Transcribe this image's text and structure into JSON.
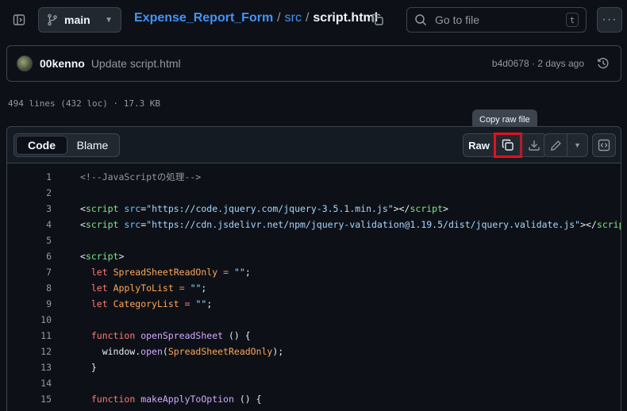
{
  "header": {
    "branch": "main",
    "breadcrumb": {
      "repo": "Expense_Report_Form",
      "sep1": "/",
      "dir": "src",
      "sep2": "/",
      "file": "script.html"
    },
    "search_placeholder": "Go to file",
    "search_shortcut": "t"
  },
  "commit": {
    "author": "00kenno",
    "message": "Update script.html",
    "meta": "b4d0678 · 2 days ago"
  },
  "file_info": "494 lines (432 loc) · 17.3 KB",
  "file_header": {
    "tabs": [
      "Code",
      "Blame"
    ],
    "active_tab": "Code",
    "raw_label": "Raw",
    "tooltip": "Copy raw file"
  },
  "code_lines": [
    {
      "n": "1",
      "tokens": [
        [
          "c",
          "<!--JavaScriptの処理-->"
        ]
      ]
    },
    {
      "n": "2",
      "tokens": []
    },
    {
      "n": "3",
      "tokens": [
        [
          "p",
          "<"
        ],
        [
          "t",
          "script"
        ],
        [
          "p",
          " "
        ],
        [
          "a",
          "src"
        ],
        [
          "p",
          "="
        ],
        [
          "s",
          "\"https://code.jquery.com/jquery-3.5.1.min.js\""
        ],
        [
          "p",
          "></"
        ],
        [
          "t",
          "script"
        ],
        [
          "p",
          ">"
        ]
      ]
    },
    {
      "n": "4",
      "tokens": [
        [
          "p",
          "<"
        ],
        [
          "t",
          "script"
        ],
        [
          "p",
          " "
        ],
        [
          "a",
          "src"
        ],
        [
          "p",
          "="
        ],
        [
          "s",
          "\"https://cdn.jsdelivr.net/npm/jquery-validation@1.19.5/dist/jquery.validate.js\""
        ],
        [
          "p",
          "></"
        ],
        [
          "t",
          "script"
        ],
        [
          "p",
          ">"
        ]
      ]
    },
    {
      "n": "5",
      "tokens": []
    },
    {
      "n": "6",
      "tokens": [
        [
          "p",
          "<"
        ],
        [
          "t",
          "script"
        ],
        [
          "p",
          ">"
        ]
      ]
    },
    {
      "n": "7",
      "tokens": [
        [
          "p",
          "  "
        ],
        [
          "k",
          "let"
        ],
        [
          "p",
          " "
        ],
        [
          "v",
          "SpreadSheetReadOnly"
        ],
        [
          "p",
          " "
        ],
        [
          "k",
          "="
        ],
        [
          "p",
          " "
        ],
        [
          "s",
          "\"\""
        ],
        [
          "p",
          ";"
        ]
      ]
    },
    {
      "n": "8",
      "tokens": [
        [
          "p",
          "  "
        ],
        [
          "k",
          "let"
        ],
        [
          "p",
          " "
        ],
        [
          "v",
          "ApplyToList"
        ],
        [
          "p",
          " "
        ],
        [
          "k",
          "="
        ],
        [
          "p",
          " "
        ],
        [
          "s",
          "\"\""
        ],
        [
          "p",
          ";"
        ]
      ]
    },
    {
      "n": "9",
      "tokens": [
        [
          "p",
          "  "
        ],
        [
          "k",
          "let"
        ],
        [
          "p",
          " "
        ],
        [
          "v",
          "CategoryList"
        ],
        [
          "p",
          " "
        ],
        [
          "k",
          "="
        ],
        [
          "p",
          " "
        ],
        [
          "s",
          "\"\""
        ],
        [
          "p",
          ";"
        ]
      ]
    },
    {
      "n": "10",
      "tokens": []
    },
    {
      "n": "11",
      "tokens": [
        [
          "p",
          "  "
        ],
        [
          "k",
          "function"
        ],
        [
          "p",
          " "
        ],
        [
          "f",
          "openSpreadSheet"
        ],
        [
          "p",
          " () {"
        ]
      ]
    },
    {
      "n": "12",
      "tokens": [
        [
          "p",
          "    window."
        ],
        [
          "f",
          "open"
        ],
        [
          "p",
          "("
        ],
        [
          "v",
          "SpreadSheetReadOnly"
        ],
        [
          "p",
          ");"
        ]
      ]
    },
    {
      "n": "13",
      "tokens": [
        [
          "p",
          "  }"
        ]
      ]
    },
    {
      "n": "14",
      "tokens": []
    },
    {
      "n": "15",
      "tokens": [
        [
          "p",
          "  "
        ],
        [
          "k",
          "function"
        ],
        [
          "p",
          " "
        ],
        [
          "f",
          "makeApplyToOption"
        ],
        [
          "p",
          " () {"
        ]
      ]
    }
  ]
}
